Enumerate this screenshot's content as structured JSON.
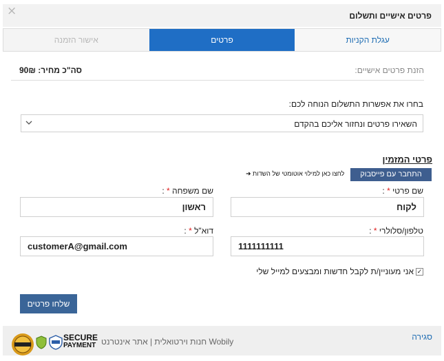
{
  "modal": {
    "close_icon": "×",
    "title": "פרטים אישיים ותשלום"
  },
  "steps": [
    {
      "label": "עגלת הקניות",
      "state": "done"
    },
    {
      "label": "פרטים",
      "state": "active"
    },
    {
      "label": "אישור הזמנה",
      "state": "pending"
    }
  ],
  "summary": {
    "label": "הזנת פרטים אישיים:",
    "total": "סה\"כ מחיר: 90₪"
  },
  "payment": {
    "prompt": "בחרו את אפשרות התשלום הנוחה לכם:",
    "selected": "השאירו פרטים ונחזור אליכם בהקדם",
    "arrow_icon": "chevron-down-icon"
  },
  "orderer": {
    "section_title": "פרטי המזמין",
    "facebook_button": "התחבר עם פייסבוק",
    "facebook_hint": "לחצו כאן למילוי אוטומטי של השדות ➜",
    "first_name_label": "שם פרטי",
    "last_name_label": "שם משפחה",
    "phone_label": "טלפון/סלולרי",
    "email_label": "דוא\"ל",
    "required_mark": "*",
    "colon": " :",
    "first_name_value": "לקוח",
    "last_name_value": "ראשון",
    "phone_value": "1111111111",
    "email_value": "customerA@gmail.com",
    "newsletter_label": "אני מעוניין/ת לקבל חדשות ומבצעים למייל שלי",
    "newsletter_checked": true,
    "check_glyph": "✓",
    "submit_label": "שלחו פרטים"
  },
  "footer": {
    "close_link": "סגירה",
    "brand_text": "Wobily חנות וירטואלית | אתר אינטרנט",
    "secure_line1": "SECURE",
    "secure_line2": "PAYMENT",
    "seal_icon": "secure-seal-icon",
    "shield_icon": "shield-icon",
    "pci_icon": "pci-icon"
  },
  "colors": {
    "accent": "#1f6ec5",
    "facebook": "#3e5e8f",
    "submit": "#3a6598",
    "required": "#e01b1b",
    "link": "#1f6db3"
  }
}
